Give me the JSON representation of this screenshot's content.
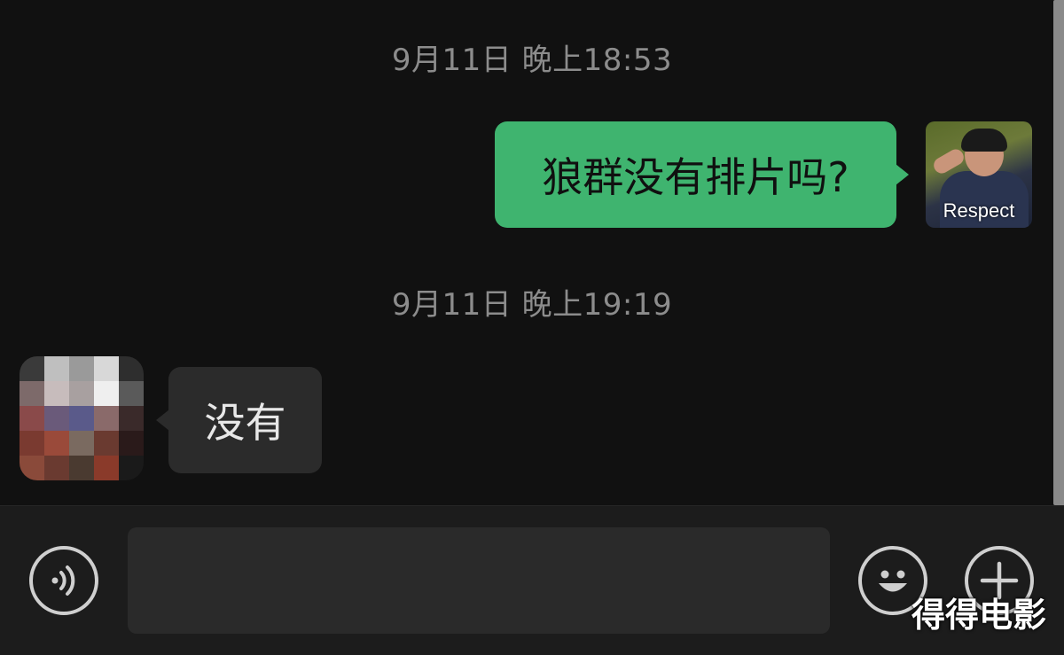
{
  "messages": {
    "timestamp_1": "9月11日 晚上18:53",
    "outgoing_text": "狼群没有排片吗?",
    "timestamp_2": "9月11日 晚上19:19",
    "incoming_text": "没有"
  },
  "avatar_self": {
    "caption": "Respect"
  },
  "avatar_other": {
    "blurred": true
  },
  "input_bar": {
    "input_value": "",
    "voice_icon": "voice-icon",
    "emoji_icon": "emoji-icon",
    "add_icon": "plus-icon"
  },
  "watermark": "得得电影",
  "colors": {
    "background": "#111111",
    "outgoing_bubble": "#3fb46f",
    "incoming_bubble": "#2b2b2b",
    "timestamp": "#8c8c8c"
  }
}
